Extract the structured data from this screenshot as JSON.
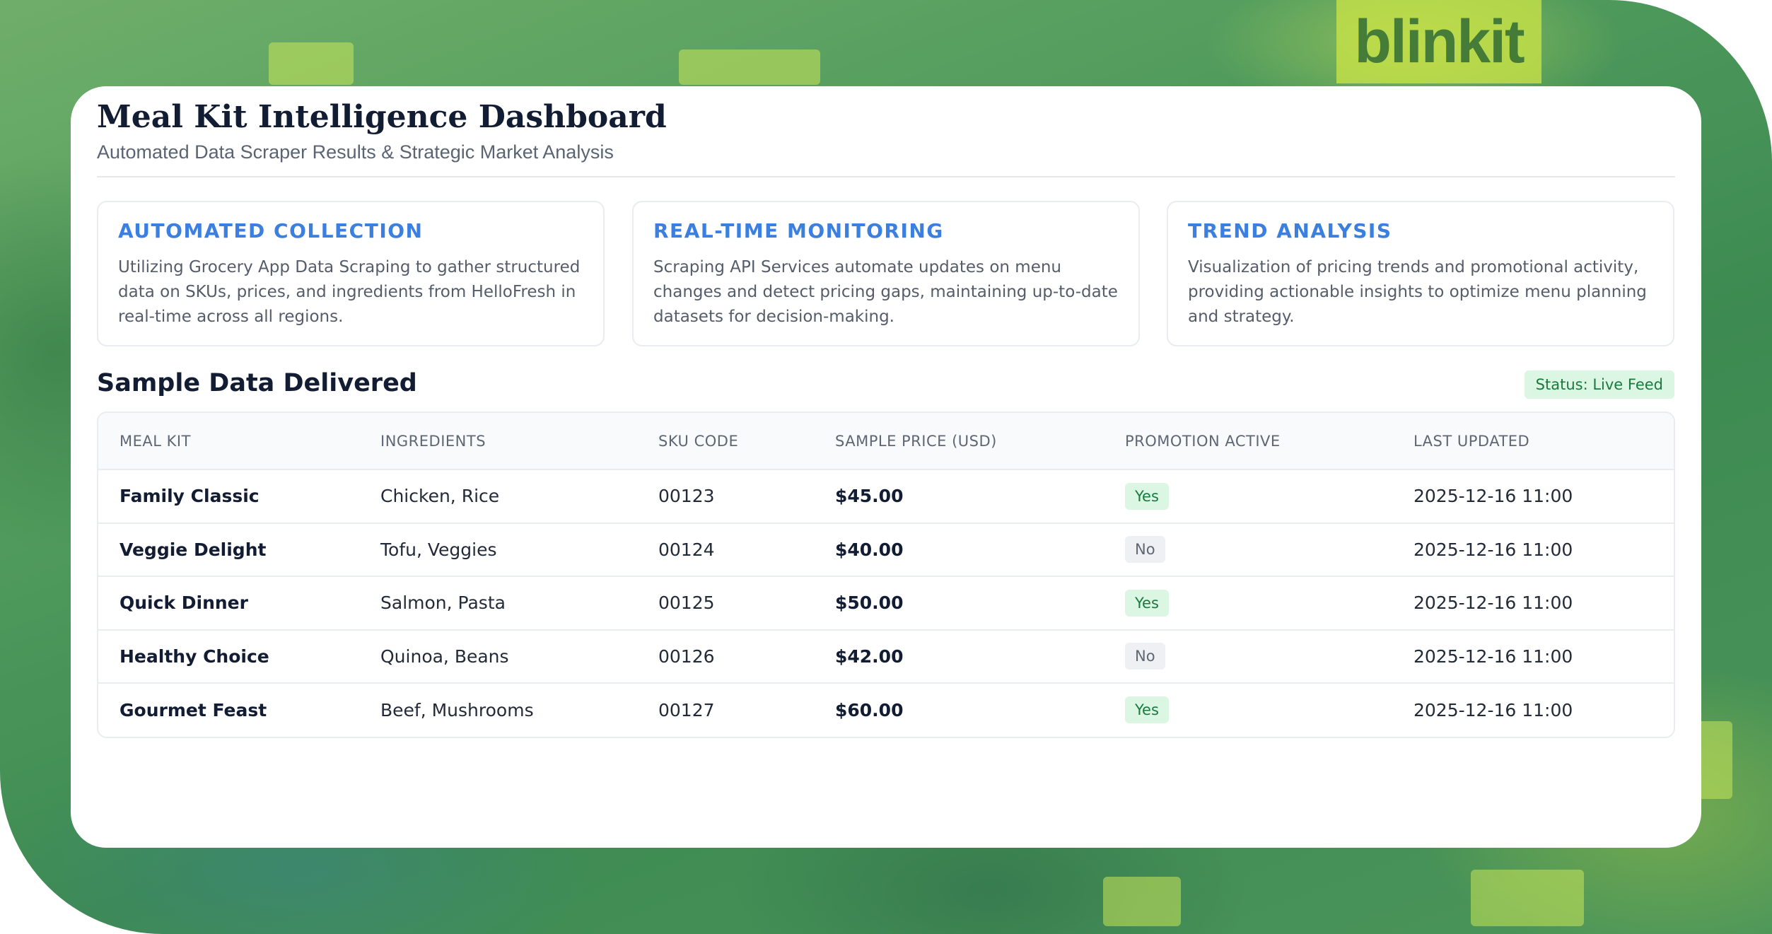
{
  "background": {
    "logo_text": "blinkit"
  },
  "header": {
    "title": "Meal Kit Intelligence Dashboard",
    "subtitle": "Automated Data Scraper Results & Strategic Market Analysis"
  },
  "features": [
    {
      "title": "AUTOMATED COLLECTION",
      "text": "Utilizing Grocery App Data Scraping to gather structured data on SKUs, prices, and ingredients from HelloFresh in real-time across all regions."
    },
    {
      "title": "REAL-TIME MONITORING",
      "text": "Scraping API Services automate updates on menu changes and detect pricing gaps, maintaining up-to-date datasets for decision-making."
    },
    {
      "title": "TREND ANALYSIS",
      "text": "Visualization of pricing trends and promotional activity, providing actionable insights to optimize menu planning and strategy."
    }
  ],
  "sample": {
    "title": "Sample Data Delivered",
    "status": "Status: Live Feed"
  },
  "table": {
    "columns": [
      "MEAL KIT",
      "INGREDIENTS",
      "SKU CODE",
      "SAMPLE PRICE (USD)",
      "PROMOTION ACTIVE",
      "LAST UPDATED"
    ],
    "rows": [
      {
        "meal": "Family Classic",
        "ingredients": "Chicken, Rice",
        "sku": "00123",
        "price": "$45.00",
        "promo": "Yes",
        "updated": "2025-12-16 11:00"
      },
      {
        "meal": "Veggie Delight",
        "ingredients": "Tofu, Veggies",
        "sku": "00124",
        "price": "$40.00",
        "promo": "No",
        "updated": "2025-12-16 11:00"
      },
      {
        "meal": "Quick Dinner",
        "ingredients": "Salmon, Pasta",
        "sku": "00125",
        "price": "$50.00",
        "promo": "Yes",
        "updated": "2025-12-16 11:00"
      },
      {
        "meal": "Healthy Choice",
        "ingredients": "Quinoa, Beans",
        "sku": "00126",
        "price": "$42.00",
        "promo": "No",
        "updated": "2025-12-16 11:00"
      },
      {
        "meal": "Gourmet Feast",
        "ingredients": "Beef, Mushrooms",
        "sku": "00127",
        "price": "$60.00",
        "promo": "Yes",
        "updated": "2025-12-16 11:00"
      }
    ]
  },
  "colors": {
    "accent": "#3b7fe0",
    "success_bg": "#dcf6e4",
    "success_text": "#1a7a3e",
    "neutral_bg": "#eef0f3",
    "heading": "#121c33",
    "background_green": "#4f9a5c"
  }
}
